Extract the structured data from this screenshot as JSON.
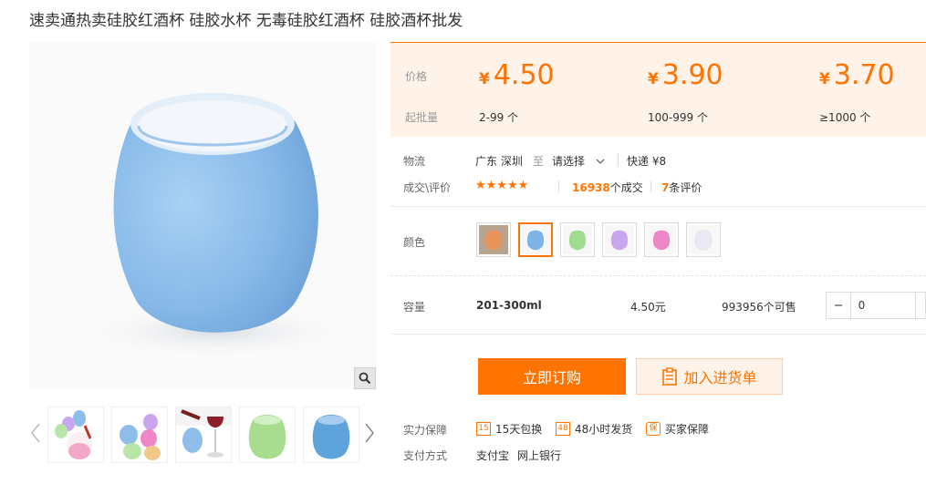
{
  "product": {
    "title": "速卖通热卖硅胶红酒杯 硅胶水杯 无毒硅胶红酒杯 硅胶酒杯批发"
  },
  "price_panel": {
    "price_label": "价格",
    "moq_label": "起批量",
    "tiers": [
      {
        "currency": "¥",
        "price": "4.50",
        "moq": "2-99 个"
      },
      {
        "currency": "¥",
        "price": "3.90",
        "moq": "100-999 个"
      },
      {
        "currency": "¥",
        "price": "3.70",
        "moq": "≥1000 个"
      }
    ]
  },
  "logistics": {
    "label": "物流",
    "origin": "广东 深圳",
    "to": "至",
    "destination": "请选择",
    "shipping": "快递 ¥8"
  },
  "reviews": {
    "label": "成交\\评价",
    "stars": "★★★★★",
    "deals_count": "16938",
    "deals_suffix": "个成交",
    "review_count": "7",
    "review_suffix": "条评价"
  },
  "color": {
    "label": "颜色",
    "selected_index": 1,
    "options": [
      {
        "name": "orange",
        "hex": "#e8935a"
      },
      {
        "name": "blue",
        "hex": "#7fb4e8"
      },
      {
        "name": "green",
        "hex": "#9fdc8f"
      },
      {
        "name": "purple",
        "hex": "#c9a6ef"
      },
      {
        "name": "pink",
        "hex": "#ee86c8"
      },
      {
        "name": "white",
        "hex": "#ebe8f3"
      }
    ]
  },
  "capacity": {
    "label": "容量",
    "value": "201-300ml",
    "unit_price": "4.50元",
    "stock": "993956个可售",
    "quantity": "0"
  },
  "actions": {
    "order_label": "立即订购",
    "cart_label": "加入进货单"
  },
  "guarantee": {
    "label": "实力保障",
    "items": [
      {
        "icon": "15",
        "text": "15天包换"
      },
      {
        "icon": "48",
        "text": "48小时发货"
      },
      {
        "icon": "保",
        "text": "买家保障"
      }
    ]
  },
  "payment": {
    "label": "支付方式",
    "methods": [
      "支付宝",
      "网上银行"
    ]
  },
  "colors": {
    "accent": "#ff7300",
    "panel_bg": "#fff2e8",
    "cup_blue": "#8fbde9"
  },
  "icons": {
    "zoom": "magnifier-icon",
    "prev": "chevron-left-icon",
    "next": "chevron-right-icon",
    "dropdown": "chevron-down-icon",
    "cart": "clipboard-icon"
  }
}
